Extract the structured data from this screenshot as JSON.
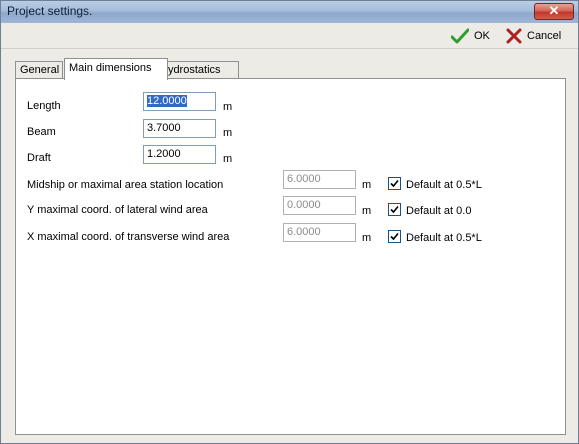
{
  "window": {
    "title": "Project settings."
  },
  "toolbar": {
    "ok_label": "OK",
    "cancel_label": "Cancel"
  },
  "tabs": [
    {
      "label": "General",
      "active": false
    },
    {
      "label": "Main dimensions",
      "active": true
    },
    {
      "label": "Hydrostatics",
      "active": false
    }
  ],
  "main_dimensions": {
    "length": {
      "label": "Length",
      "value": "12.0000",
      "unit": "m"
    },
    "beam": {
      "label": "Beam",
      "value": "3.7000",
      "unit": "m"
    },
    "draft": {
      "label": "Draft",
      "value": "1.2000",
      "unit": "m"
    },
    "midship": {
      "label": "Midship or maximal area station location",
      "value": "6.0000",
      "unit": "m",
      "checkbox_label": "Default at 0.5*L",
      "checked": true
    },
    "y_wind": {
      "label": "Y maximal coord. of lateral wind area",
      "value": "0.0000",
      "unit": "m",
      "checkbox_label": "Default at 0.0",
      "checked": true
    },
    "x_wind": {
      "label": "X maximal coord. of transverse wind area",
      "value": "6.0000",
      "unit": "m",
      "checkbox_label": "Default at 0.5*L",
      "checked": true
    }
  },
  "colors": {
    "ok_check": "#2e9e2e",
    "cancel_x": "#b01e1e",
    "selection": "#316ac5"
  }
}
